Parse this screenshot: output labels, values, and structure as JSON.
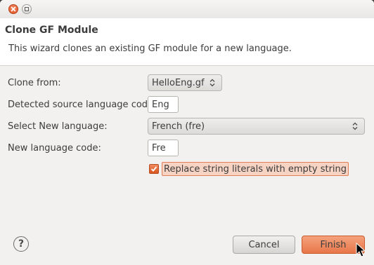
{
  "window": {
    "close_icon": "close-icon",
    "maximize_icon": "maximize-icon"
  },
  "header": {
    "title": "Clone GF Module",
    "description": "This wizard clones an existing GF module for a new language."
  },
  "form": {
    "clone_from_label": "Clone from:",
    "clone_from_value": "HelloEng.gf",
    "source_code_label": "Detected source language code:",
    "source_code_value": "Eng",
    "new_language_label": "Select New language:",
    "new_language_value": "French (fre)",
    "new_code_label": "New language code:",
    "new_code_value": "Fre",
    "replace_label": "Replace string literals with empty string",
    "replace_checked": true
  },
  "footer": {
    "help_symbol": "?",
    "cancel_label": "Cancel",
    "finish_label": "Finish"
  },
  "colors": {
    "accent": "#e8764a",
    "background": "#f2f1f0",
    "header_background": "#ffffff"
  }
}
